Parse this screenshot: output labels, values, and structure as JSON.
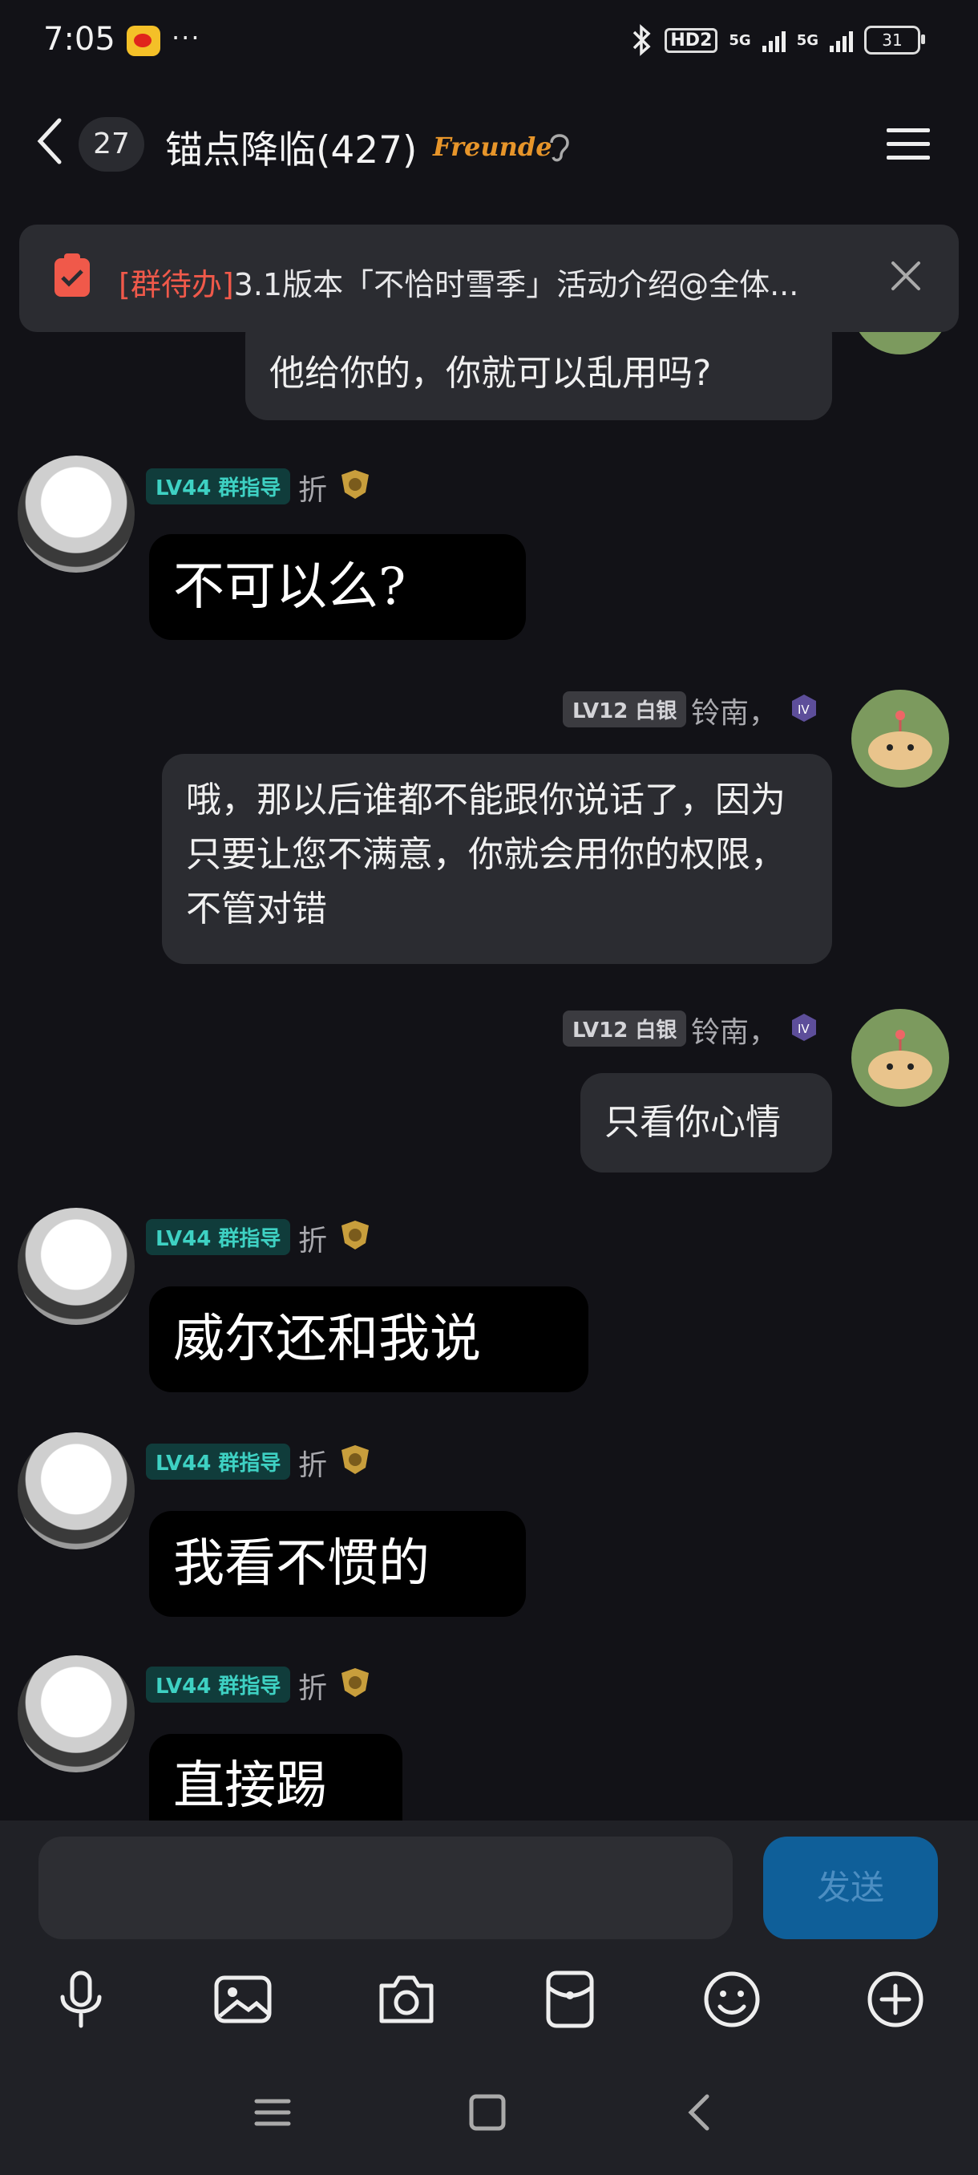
{
  "status_bar": {
    "time": "7:05",
    "dots": "···",
    "hd": "HD2",
    "net1": "5G",
    "net2": "5G",
    "battery": "31"
  },
  "header": {
    "unread": "27",
    "title": "锚点降临(427)",
    "logo_text": "Freunde"
  },
  "pinned_todo": {
    "tag": "[群待办]",
    "text": "3.1版本「不恰时雪季」活动介绍@全体..."
  },
  "messages": [
    {
      "side": "right",
      "text": "他给你的，你就可以乱用吗?"
    },
    {
      "side": "left",
      "badge": "LV44 群指导",
      "nick": "折",
      "text": "不可以么?"
    },
    {
      "side": "right",
      "badge": "LV12 白银",
      "nick": "铃南，",
      "text": "哦，那以后谁都不能跟你说话了，因为只要让您不满意，你就会用你的权限，不管对错"
    },
    {
      "side": "right",
      "badge": "LV12 白银",
      "nick": "铃南，",
      "text": "只看你心情"
    },
    {
      "side": "left",
      "badge": "LV44 群指导",
      "nick": "折",
      "text": "威尔还和我说"
    },
    {
      "side": "left",
      "badge": "LV44 群指导",
      "nick": "折",
      "text": "我看不惯的"
    },
    {
      "side": "left",
      "badge": "LV44 群指导",
      "nick": "折",
      "text": "直接踢"
    }
  ],
  "composer": {
    "input_value": "",
    "send_label": "发送"
  },
  "toolbar_icons": [
    "microphone-icon",
    "image-icon",
    "camera-icon",
    "red-packet-icon",
    "emoji-icon",
    "plus-icon"
  ],
  "colors": {
    "background": "#121217",
    "bubble": "#2b2c31",
    "accent_send": "#0f5f99",
    "lv44": "#3ed1c3",
    "todo_tag": "#f0594a"
  }
}
